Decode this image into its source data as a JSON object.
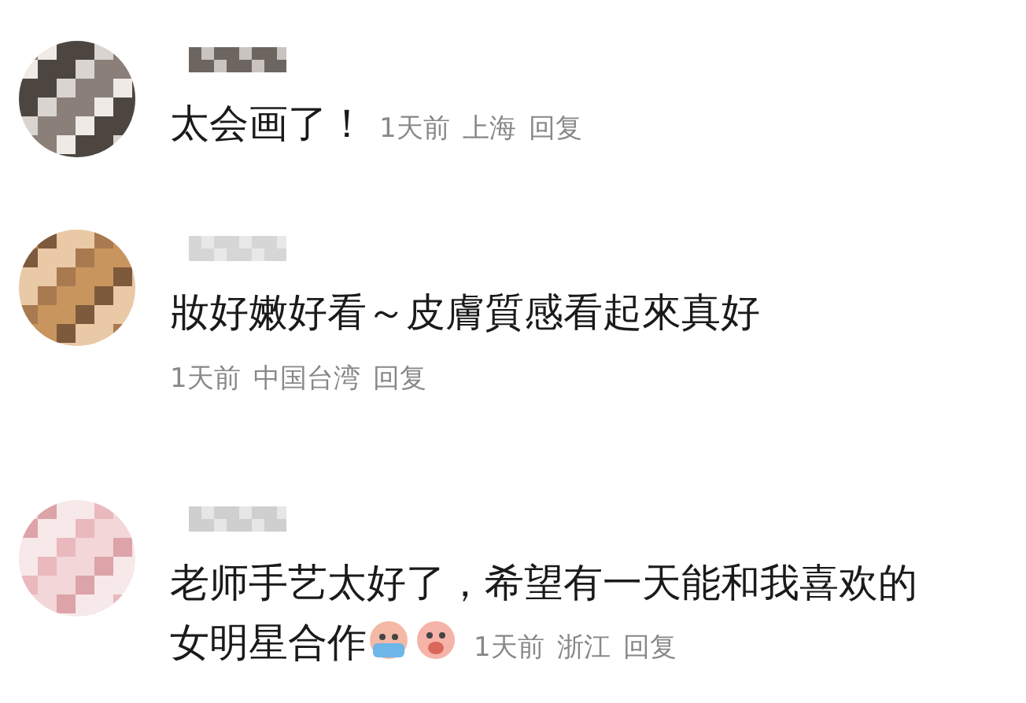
{
  "comments": [
    {
      "lines": [
        "太会画了！"
      ],
      "meta_inline": true,
      "time": "1天前",
      "location": "上海",
      "reply": "回复"
    },
    {
      "lines": [
        "妝好嫩好看～皮膚質感看起來真好"
      ],
      "meta_inline": false,
      "time": "1天前",
      "location": "中国台湾",
      "reply": "回复"
    },
    {
      "lines": [
        "老师手艺太好了，希望有一天能和我喜欢的",
        "女明星合作"
      ],
      "meta_inline": true,
      "emojis": [
        {
          "kind": "crying"
        },
        {
          "kind": "pig"
        }
      ],
      "time": "1天前",
      "location": "浙江",
      "reply": "回复"
    }
  ]
}
